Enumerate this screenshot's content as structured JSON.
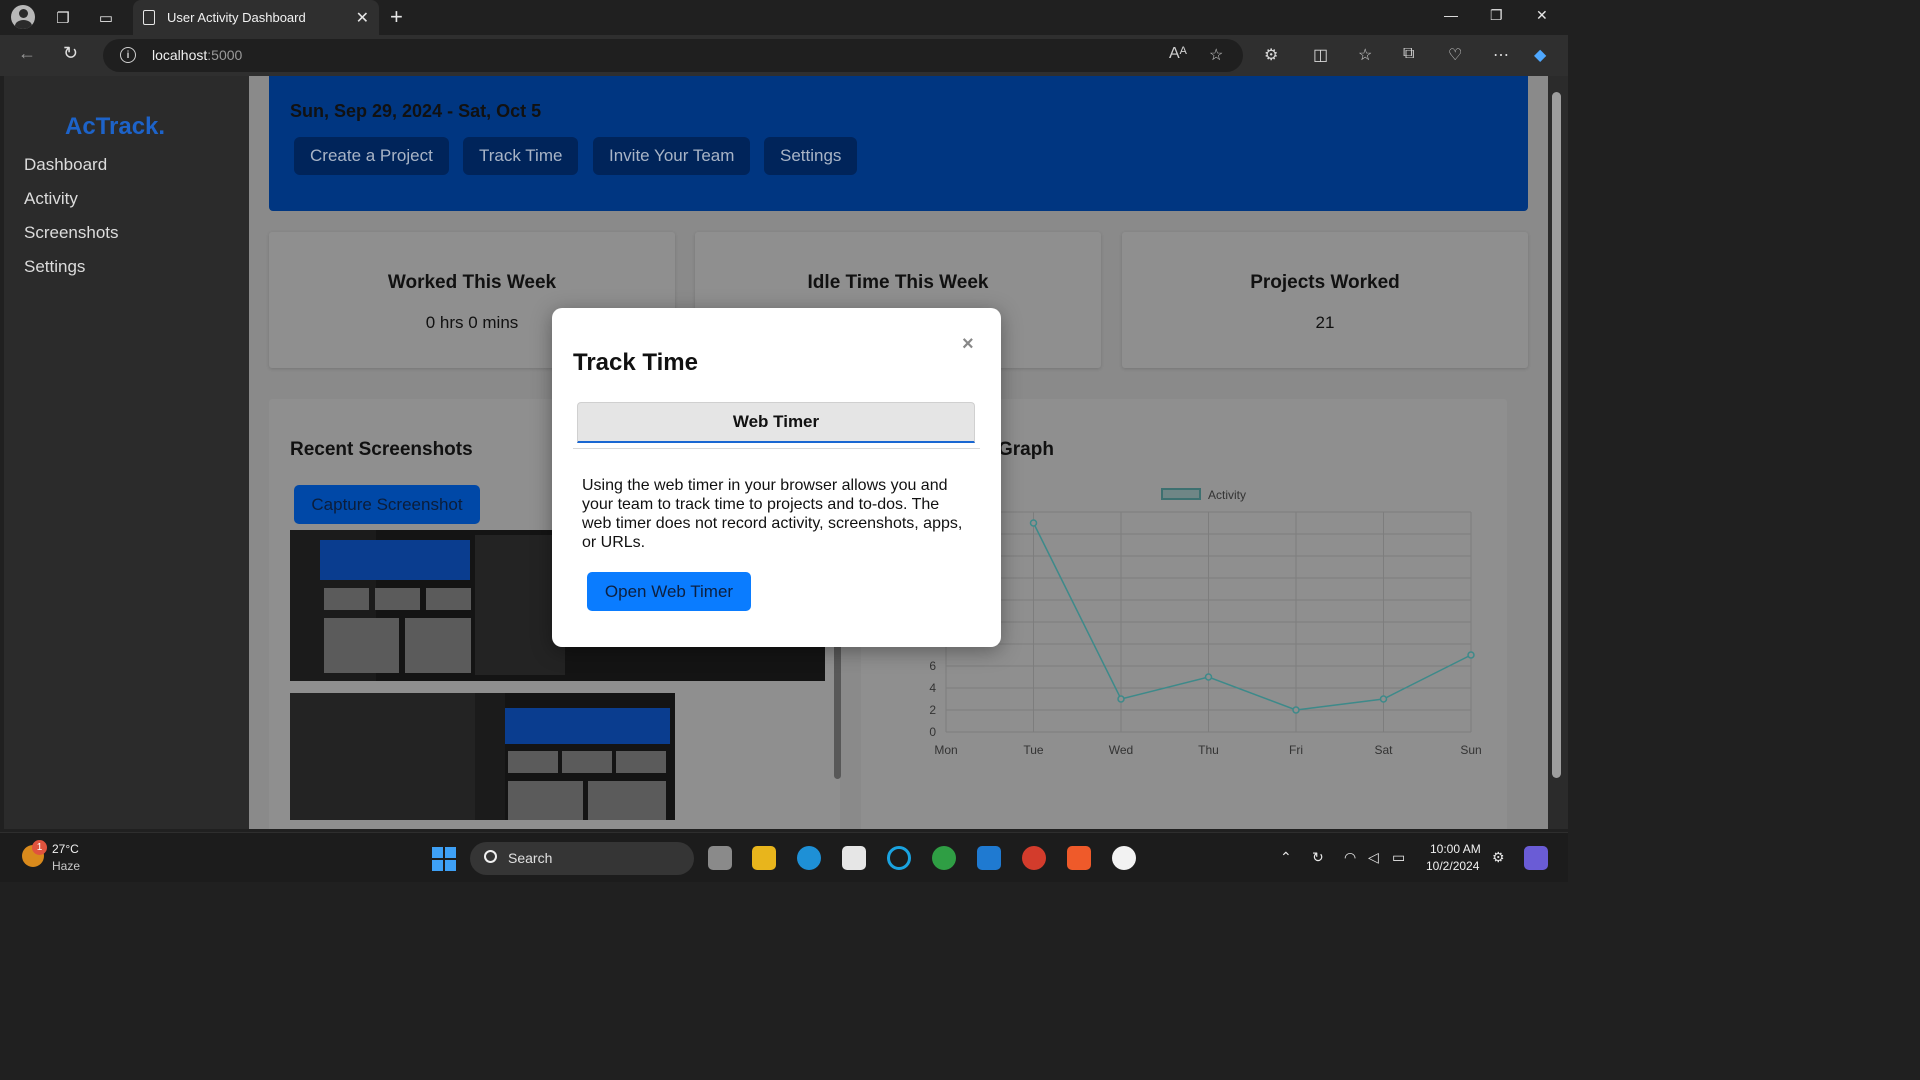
{
  "browser": {
    "tab_title": "User Activity Dashboard",
    "url_host": "localhost",
    "url_port": ":5000"
  },
  "sidebar": {
    "brand": "AcTrack.",
    "items": [
      {
        "label": "Dashboard"
      },
      {
        "label": "Activity"
      },
      {
        "label": "Screenshots"
      },
      {
        "label": "Settings"
      }
    ]
  },
  "hero": {
    "date_range": "Sun, Sep 29, 2024 - Sat, Oct 5",
    "buttons": [
      {
        "label": "Create a Project"
      },
      {
        "label": "Track Time"
      },
      {
        "label": "Invite Your Team"
      },
      {
        "label": "Settings"
      }
    ]
  },
  "stats": [
    {
      "title": "Worked This Week",
      "value": "0 hrs 0 mins"
    },
    {
      "title": "Idle Time This Week",
      "value": ""
    },
    {
      "title": "Projects Worked",
      "value": "21"
    }
  ],
  "screenshots_panel": {
    "title": "Recent Screenshots",
    "capture_label": "Capture Screenshot"
  },
  "graph_panel": {
    "title_visible": "Graph"
  },
  "chart_data": {
    "type": "line",
    "categories": [
      "Mon",
      "Tue",
      "Wed",
      "Thu",
      "Fri",
      "Sat",
      "Sun"
    ],
    "series": [
      {
        "name": "Activity",
        "values": [
          null,
          19,
          3,
          5,
          2,
          3,
          7
        ]
      }
    ],
    "yticks_visible": [
      "6",
      "4",
      "2",
      "0"
    ],
    "ylim": [
      0,
      20
    ],
    "legend": "top",
    "grid": true,
    "line_color": "#3d8a8a"
  },
  "modal": {
    "title": "Track Time",
    "close_symbol": "×",
    "tab_label": "Web Timer",
    "description": "Using the web timer in your browser allows you and your team to track time to projects and to-dos. The web timer does not record activity, screenshots, apps, or URLs.",
    "button_label": "Open Web Timer"
  },
  "taskbar": {
    "weather_temp": "27°C",
    "weather_desc": "Haze",
    "weather_badge": "1",
    "search_label": "Search",
    "time": "10:00 AM",
    "date": "10/2/2024"
  }
}
